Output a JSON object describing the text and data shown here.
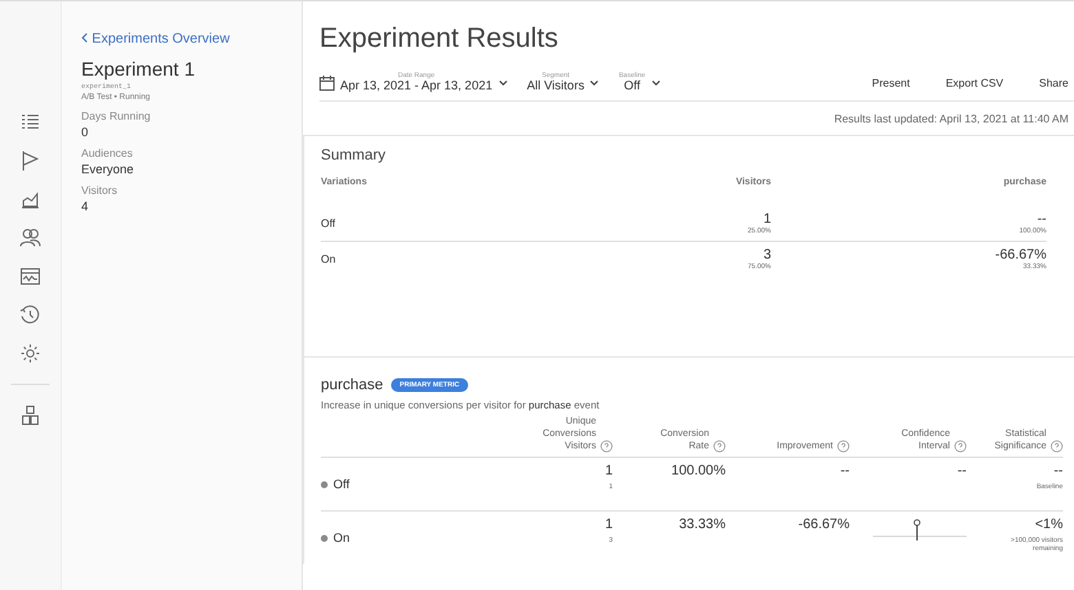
{
  "sidebar": {
    "back_link": "Experiments Overview",
    "title": "Experiment 1",
    "key": "experiment_1",
    "subtitle": "A/B Test • Running",
    "stats": [
      {
        "label": "Days Running",
        "value": "0"
      },
      {
        "label": "Audiences",
        "value": "Everyone"
      },
      {
        "label": "Visitors",
        "value": "4"
      }
    ]
  },
  "header": {
    "title": "Experiment Results",
    "filters": [
      {
        "label": "Date Range",
        "value": "Apr 13, 2021 - Apr 13, 2021",
        "icon": true
      },
      {
        "label": "Segment",
        "value": "All Visitors",
        "icon": false
      },
      {
        "label": "Baseline",
        "value": "Off",
        "icon": false
      }
    ],
    "actions": [
      "Present",
      "Export CSV",
      "Share"
    ],
    "updated": "Results last updated: April 13, 2021 at 11:40 AM"
  },
  "summary": {
    "title": "Summary",
    "columns": [
      "Variations",
      "Visitors",
      "purchase"
    ],
    "rows": [
      {
        "name": "Off",
        "visitors": "1",
        "visitors_share": "25.00%",
        "metric": "--",
        "metric_share": "100.00%"
      },
      {
        "name": "On",
        "visitors": "3",
        "visitors_share": "75.00%",
        "metric": "-66.67%",
        "metric_share": "33.33%"
      }
    ]
  },
  "metric": {
    "name": "purchase",
    "badge": "PRIMARY METRIC",
    "description": "Increase in unique conversions per visitor for **purchase** event",
    "columns": [
      "Unique\nConversions\nVisitors",
      "Conversion\nRate",
      "Improvement",
      "Confidence\nInterval",
      "Statistical\nSignificance"
    ],
    "rows": [
      {
        "name": "Off",
        "color": "#8a8a8a",
        "conversions": "1",
        "visitors": "1",
        "rate": "100.00%",
        "improvement": "--",
        "interval": {
          "kind": "text",
          "text": "--"
        },
        "significance": "--",
        "note": "Baseline"
      },
      {
        "name": "On",
        "color": "#8a8a8a",
        "conversions": "1",
        "visitors": "3",
        "rate": "33.33%",
        "improvement": "-66.67%",
        "interval": {
          "kind": "plot"
        },
        "significance": "<1%",
        "note": ">100,000 visitors\nremaining"
      }
    ]
  }
}
